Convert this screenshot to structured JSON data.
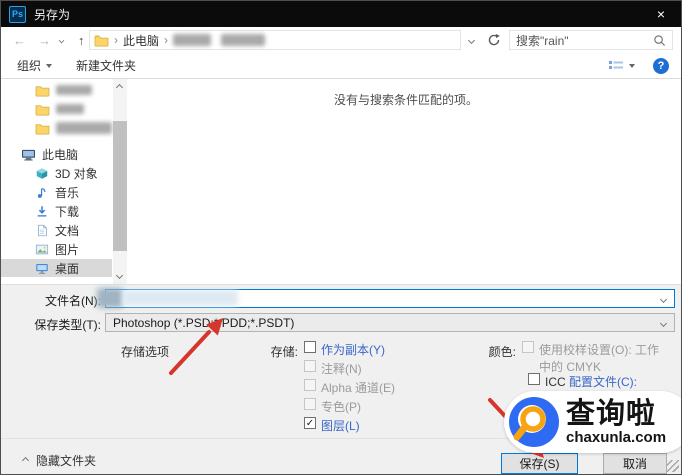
{
  "window": {
    "title": "另存为",
    "app_badge": "Ps",
    "close_glyph": "×"
  },
  "address_bar": {
    "back_glyph": "←",
    "forward_glyph": "→",
    "up_glyph": "↑",
    "breadcrumb": {
      "sep": "›",
      "root": "此电脑",
      "redacted_segments": 2
    },
    "search_value": "搜索\"rain\""
  },
  "toolbar": {
    "organize_label": "组织",
    "new_folder_label": "新建文件夹"
  },
  "sidebar": {
    "items": [
      {
        "icon": "folder",
        "redacted": true
      },
      {
        "icon": "folder",
        "redacted": true
      },
      {
        "icon": "folder",
        "redacted": true
      },
      {
        "icon": "this-pc",
        "label": "此电脑"
      },
      {
        "icon": "3d-objects",
        "label": "3D 对象"
      },
      {
        "icon": "music",
        "label": "音乐"
      },
      {
        "icon": "downloads",
        "label": "下载"
      },
      {
        "icon": "documents",
        "label": "文档"
      },
      {
        "icon": "pictures",
        "label": "图片"
      },
      {
        "icon": "desktop",
        "label": "桌面",
        "selected": true
      }
    ]
  },
  "main": {
    "empty_message": "没有与搜索条件匹配的项。"
  },
  "form": {
    "file_name_label": "文件名(N):",
    "file_name_value": "",
    "save_type_label": "保存类型(T):",
    "save_type_value": "Photoshop (*.PSD;*.PDD;*.PSDT)"
  },
  "options": {
    "section_label": "存储选项",
    "save_group_label": "存储:",
    "save_items": [
      {
        "label": "作为副本(Y)",
        "checked": false,
        "enabled": true,
        "glyph": ""
      },
      {
        "label": "注释(N)",
        "checked": false,
        "enabled": false,
        "glyph": ""
      },
      {
        "label": "Alpha 通道(E)",
        "checked": false,
        "enabled": false,
        "glyph": ""
      },
      {
        "label": "专色(P)",
        "checked": false,
        "enabled": false,
        "glyph": ""
      },
      {
        "label": "图层(L)",
        "checked": true,
        "enabled": true,
        "glyph": "✓"
      }
    ],
    "color_group_label": "颜色:",
    "color_items": [
      {
        "label": "使用校样设置(O): 工作中的 CMYK",
        "checked": false,
        "enabled": false
      },
      {
        "parts": [
          {
            "text": "ICC "
          },
          {
            "text": "配置文件(C):"
          }
        ],
        "checked": false,
        "enabled": true
      }
    ]
  },
  "footer": {
    "hide_folders_label": "隐藏文件夹",
    "save_label": "保存(S)",
    "cancel_label": "取消"
  },
  "watermark": {
    "brand": "查询啦",
    "domain": "chaxunla.com"
  },
  "colors": {
    "accent_blue": "#0078d7",
    "link_blue": "#3a66c8",
    "title_bar": "#0b0b0b",
    "panel_gray": "#f0f0f0",
    "arrow_red": "#d6352b",
    "logo_blue": "#2e6bf2",
    "logo_orange": "#f7a312"
  }
}
